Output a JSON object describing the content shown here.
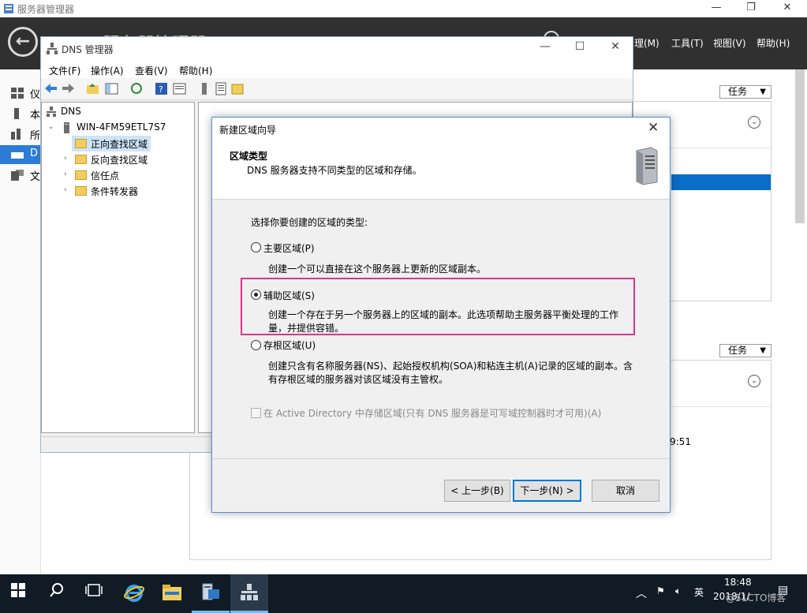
{
  "server_manager": {
    "window_title": "服务器管理器",
    "big_title": "服务器管理器 · DNS",
    "menus": [
      "理(M)",
      "工具(T)",
      "视图(V)",
      "帮助(H)"
    ],
    "nav_items": [
      "仪",
      "本",
      "所",
      "D",
      "文"
    ],
    "tasks_label_1": "任务",
    "tasks_label_2": "任务",
    "time_fragment": "9:51"
  },
  "dns_manager": {
    "title": "DNS 管理器",
    "menu": [
      "文件(F)",
      "操作(A)",
      "查看(V)",
      "帮助(H)"
    ],
    "tree": {
      "root": "DNS",
      "server": "WIN-4FM59ETL7S7",
      "items": [
        "正向查找区域",
        "反向查找区域",
        "信任点",
        "条件转发器"
      ]
    }
  },
  "wizard": {
    "title": "新建区域向导",
    "heading": "区域类型",
    "subheading": "DNS 服务器支持不同类型的区域和存储。",
    "prompt": "选择你要创建的区域的类型:",
    "options": [
      {
        "label": "主要区域(P)",
        "desc_lines": [
          "创建一个可以直接在这个服务器上更新的区域副本。"
        ],
        "selected": false
      },
      {
        "label": "辅助区域(S)",
        "desc_lines": [
          "创建一个存在于另一个服务器上的区域的副本。此选项帮助主服务器平衡处理的工作",
          "量，并提供容错。"
        ],
        "selected": true
      },
      {
        "label": "存根区域(U)",
        "desc_lines": [
          "创建只含有名称服务器(NS)、起始授权机构(SOA)和粘连主机(A)记录的区域的副本。含",
          "有存根区域的服务器对该区域没有主管权。"
        ],
        "selected": false
      }
    ],
    "ad_checkbox": "在 Active Directory 中存储区域(只有 DNS 服务器是可写域控制器时才可用)(A)",
    "buttons": {
      "back": "< 上一步(B)",
      "next": "下一步(N) >",
      "cancel": "取消"
    },
    "highlight_color": "#e0328c"
  },
  "taskbar": {
    "time": "18:48",
    "date": "2018/1/",
    "lang": "英",
    "watermark": "@51CTO博客"
  }
}
